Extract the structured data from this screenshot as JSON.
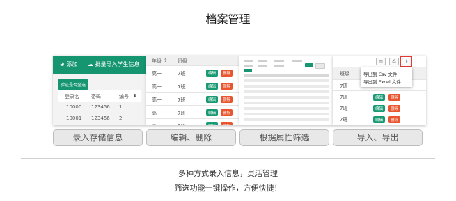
{
  "title": "档案管理",
  "colors": {
    "accent_green": "#159570",
    "danger": "#e8552f",
    "highlight": "#e53935"
  },
  "card1": {
    "add_label": "添加",
    "import_label": "批量导入学生信息",
    "verify_label": "验证是否全选",
    "headers": [
      "登录名",
      "密码",
      "编号"
    ],
    "rows": [
      [
        "10000",
        "123456",
        "1"
      ],
      [
        "10001",
        "123456",
        "2"
      ]
    ]
  },
  "card2": {
    "headers": [
      "年级",
      "班级"
    ],
    "edit_label": "编辑",
    "delete_label": "删除",
    "rows": [
      [
        "高一",
        "7班"
      ],
      [
        "高一",
        "7班"
      ],
      [
        "高一",
        "7班"
      ],
      [
        "高一",
        "7班"
      ],
      [
        "高一",
        "7班"
      ]
    ]
  },
  "card4": {
    "header": "班级",
    "export_menu": [
      "导出到 Csv 文件",
      "导出到 Excel 文件"
    ],
    "edit_label": "编辑",
    "delete_label": "删除",
    "rows": [
      "7班",
      "7班",
      "7班",
      "7班"
    ]
  },
  "captions": [
    "录入存储信息",
    "编辑、删除",
    "根据属性筛选",
    "导入、导出"
  ],
  "footer": [
    "多种方式录入信息，灵活管理",
    "筛选功能一键操作，方便快捷！"
  ]
}
